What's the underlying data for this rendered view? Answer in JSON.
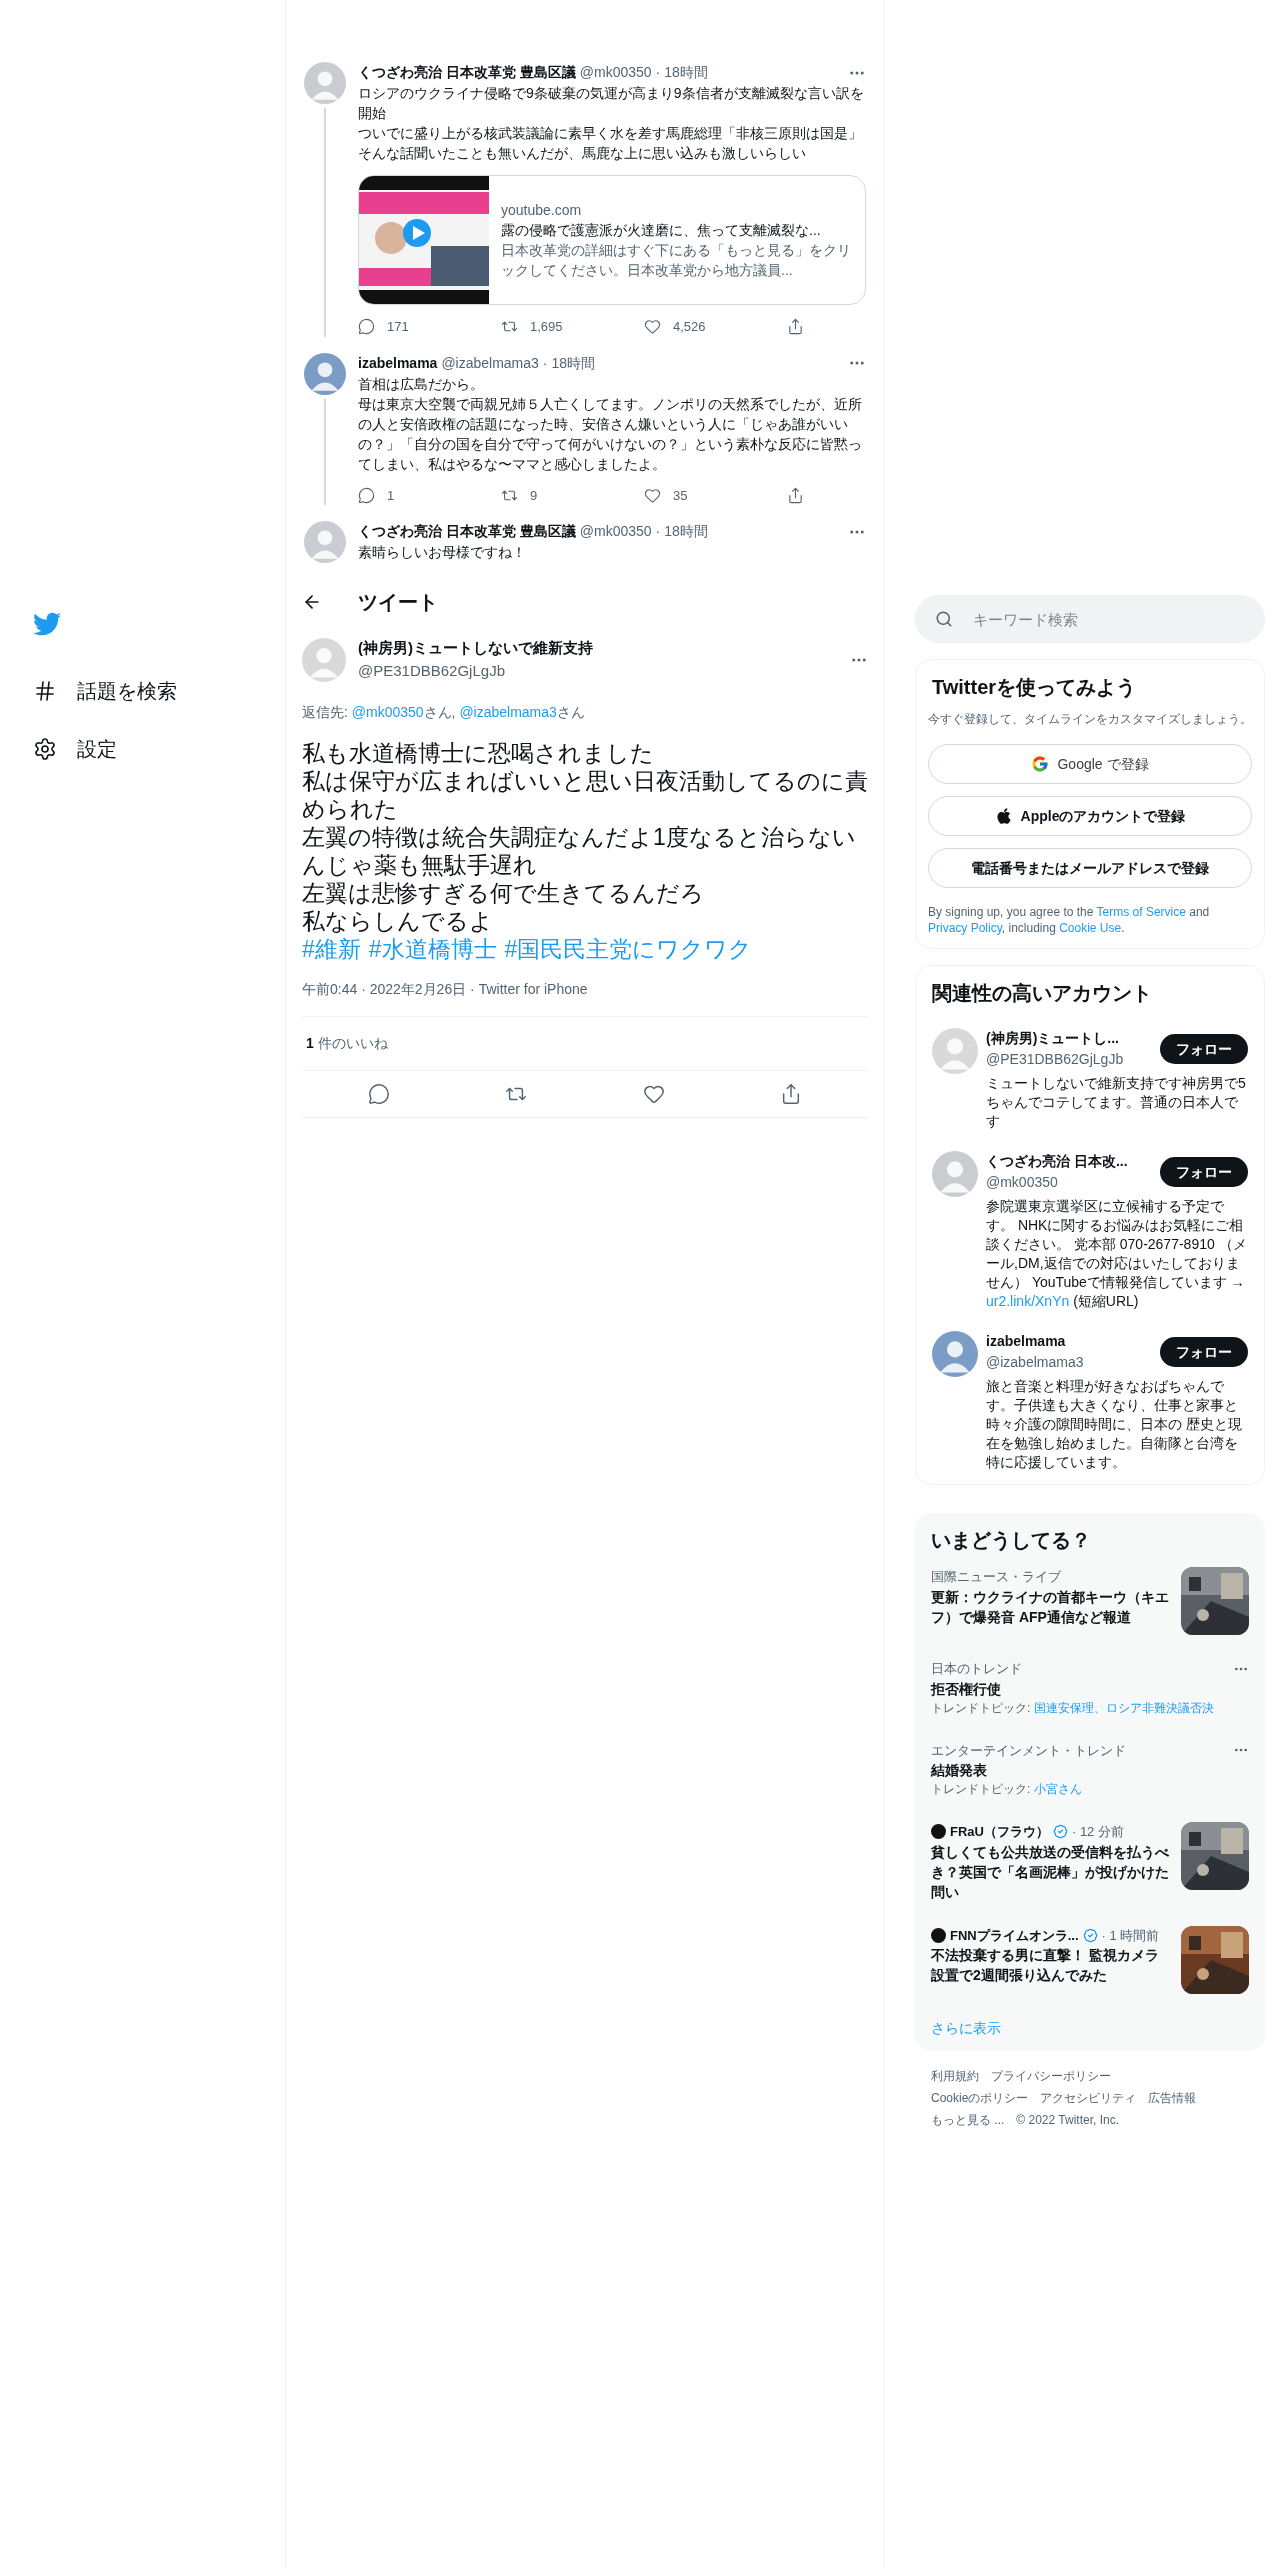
{
  "nav": {
    "items": [
      {
        "label": "話題を検索"
      },
      {
        "label": "設定"
      }
    ]
  },
  "thread": [
    {
      "name": "くつざわ亮治 日本改革党 豊島区議",
      "handle": "@mk00350",
      "time": "· 18時間",
      "lines": [
        "ロシアのウクライナ侵略で9条破棄の気運が高まり9条信者が支離滅裂な言い訳を開始",
        "ついでに盛り上がる核武装議論に素早く水を差す馬鹿総理「非核三原則は国是」そんな話聞いたことも無いんだが、馬鹿な上に思い込みも激しいらしい"
      ],
      "card": {
        "domain": "youtube.com",
        "title": "露の侵略で護憲派が火達磨に、焦って支離滅裂な...",
        "description": "日本改革党の詳細はすぐ下にある「もっと見る」をクリックしてください。日本改革党から地方議員..."
      },
      "stats": [
        "171",
        "1,695",
        "4,526"
      ]
    },
    {
      "name": "izabelmama",
      "handle": "@izabelmama3",
      "time": "· 18時間",
      "lines": [
        "首相は広島だから。",
        "母は東京大空襲で両親兄姉５人亡くしてます。ノンポリの天然系でしたが、近所の人と安倍政権の話題になった時、安倍さん嫌いという人に「じゃあ誰がいいの？」「自分の国を自分で守って何がいけないの？」という素朴な反応に皆黙ってしまい、私はやるな〜ママと感心しましたよ。"
      ],
      "stats": [
        "1",
        "9",
        "35"
      ]
    },
    {
      "name": "くつざわ亮治 日本改革党 豊島区議",
      "handle": "@mk00350",
      "time": "· 18時間",
      "lines": [
        "素晴らしいお母様ですね！"
      ]
    }
  ],
  "header": {
    "title": "ツイート"
  },
  "tweet": {
    "name": "(神房男)ミュートしないで維新支持",
    "handle": "@PE31DBB62GjLgJb",
    "reply_label": "返信先:",
    "mentions": [
      {
        "handle": "@mk00350",
        "suffix": "さん,"
      },
      {
        "handle": "@izabelmama3",
        "suffix": "さん"
      }
    ],
    "lines": [
      "私も水道橋博士に恐喝されました",
      "私は保守が広まればいいと思い日夜活動してるのに責められた",
      "左翼の特徴は統合失調症なんだよ1度なると治らないんじゃ薬も無駄手遅れ",
      "左翼は悲惨すぎる何で生きてるんだろ",
      "私ならしんでるよ"
    ],
    "hashtags": [
      "#維新",
      "#水道橋博士",
      "#国民民主党にワクワク"
    ],
    "meta": "午前0:44 · 2022年2月26日 · Twitter for iPhone",
    "like_count": "1",
    "like_label": "件のいいね"
  },
  "search": {
    "placeholder": "キーワード検索"
  },
  "signup": {
    "title": "Twitterを使ってみよう",
    "subtitle": "今すぐ登録して、タイムラインをカスタマイズしましょう。",
    "buttons": [
      {
        "kind": "google",
        "label": "Google で登録"
      },
      {
        "kind": "apple",
        "label": "Appleのアカウントで登録"
      },
      {
        "kind": "plain",
        "label": "電話番号またはメールアドレスで登録"
      }
    ],
    "legal": [
      {
        "text": "By signing up, you agree to the ",
        "link": false
      },
      {
        "text": "Terms of Service",
        "link": true
      },
      {
        "text": " and ",
        "link": false
      },
      {
        "text": "Privacy Policy",
        "link": true
      },
      {
        "text": ", including ",
        "link": false
      },
      {
        "text": "Cookie Use",
        "link": true
      },
      {
        "text": ".",
        "link": false
      }
    ]
  },
  "accounts": {
    "title": "関連性の高いアカウント",
    "items": [
      {
        "name": "(神房男)ミュートし...",
        "handle": "@PE31DBB62GjLgJb",
        "follow": "フォロー",
        "bio": [
          {
            "text": "ミュートしないで維新支持です神房男で5ちゃんでコテしてます。普通の日本人です",
            "link": false
          }
        ]
      },
      {
        "name": "くつざわ亮治 日本改...",
        "handle": "@mk00350",
        "follow": "フォロー",
        "bio": [
          {
            "text": "参院選東京選挙区に立候補する予定です。 NHKに関するお悩みはお気軽にご相談ください。 党本部 070-2677-8910 （メール,DM,返信での対応はいたしておりません） YouTubeで情報発信しています → ",
            "link": false
          },
          {
            "text": "ur2.link/XnYn",
            "link": true
          },
          {
            "text": " (短縮URL)",
            "link": false
          }
        ]
      },
      {
        "name": "izabelmama",
        "handle": "@izabelmama3",
        "follow": "フォロー",
        "bio": [
          {
            "text": "旅と音楽と料理が好きなおばちゃんです。子供達も大きくなり、仕事と家事と時々介護の隙間時間に、日本の 歴史と現在を勉強し始めました。自衛隊と台湾を特に応援しています。",
            "link": false
          }
        ]
      }
    ]
  },
  "trends": {
    "title": "いまどうしてる？",
    "items": [
      {
        "kind": "news",
        "context": "国際ニュース・ライブ",
        "title": "更新：ウクライナの首都キーウ（キエフ）で爆発音 AFP通信など報道"
      },
      {
        "kind": "trend",
        "context": "日本のトレンド",
        "title": "拒否権行使",
        "topic_label": "トレンドトピック:",
        "topics": "国連安保理、ロシア非難決議否決"
      },
      {
        "kind": "trend",
        "context": "エンターテインメント・トレンド",
        "title": "結婚発表",
        "topic_label": "トレンドトピック:",
        "topics": "小宮さん"
      },
      {
        "kind": "article",
        "source": "FRaU（フラウ）",
        "time": "· 12 分前",
        "title": "貧しくても公共放送の受信料を払うべき？英国で「名画泥棒」が投げかけた問い"
      },
      {
        "kind": "article",
        "source": "FNNプライムオンラ...",
        "time": "· 1 時間前",
        "title": "不法投棄する男に直撃！ 監視カメラ設置で2週間張り込んでみた"
      }
    ],
    "more": "さらに表示"
  },
  "footer": {
    "links": [
      "利用規約",
      "プライバシーポリシー",
      "Cookieのポリシー",
      "アクセシビリティ",
      "広告情報",
      "もっと見る ..."
    ],
    "copyright": "© 2022 Twitter, Inc."
  }
}
